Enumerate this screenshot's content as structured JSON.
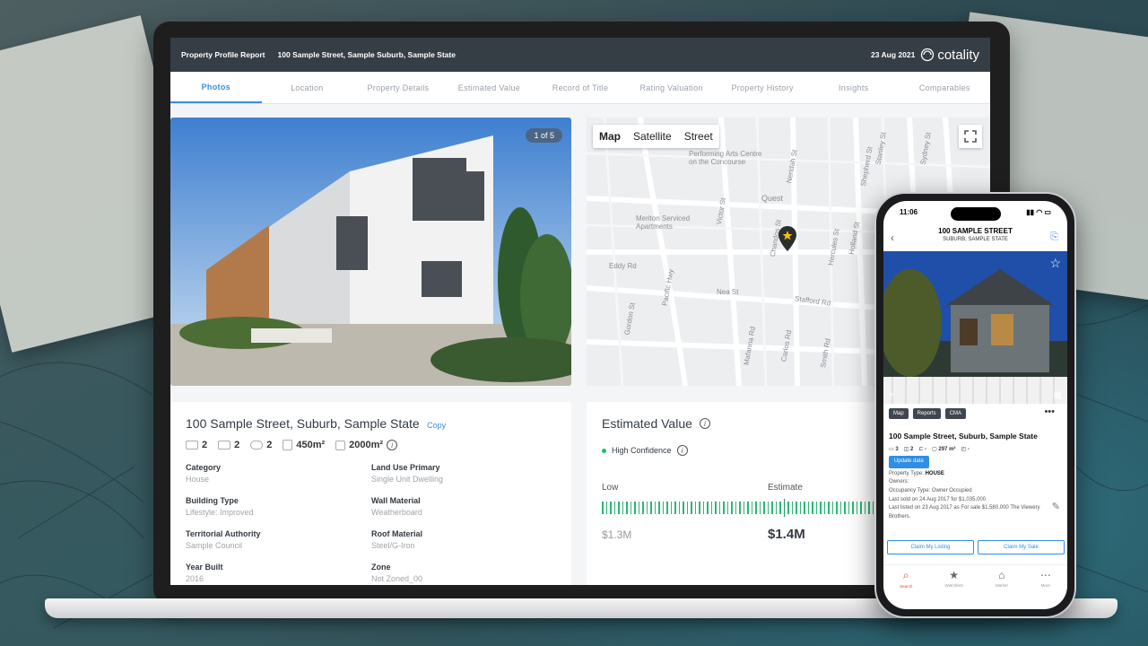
{
  "report": {
    "title": "Property Profile Report",
    "address": "100 Sample Street, Sample Suburb, Sample State",
    "date": "23 Aug 2021",
    "brand": "cotality"
  },
  "tabs": [
    "Photos",
    "Location",
    "Property Details",
    "Estimated Value",
    "Record of Title",
    "Rating Valuation",
    "Property History",
    "Insights",
    "Comparables"
  ],
  "photo": {
    "counter": "1 of 5"
  },
  "map": {
    "modes": [
      "Map",
      "Satellite",
      "Street"
    ],
    "labels": [
      "Performing Arts Centre\non the Concourse",
      "Meriton Serviced\nApartments",
      "Quest",
      "Eddy Rd",
      "Nea St",
      "Stafford Rd",
      "Pacific Hwy",
      "Victor St",
      "Chandos St",
      "Hercules St",
      "Holland St",
      "Stanley St",
      "Sydney St",
      "Neridah St",
      "Shepherd St",
      "Gordon St",
      "Mafanna Rd",
      "Carlos Rd",
      "Smith Rd"
    ]
  },
  "property": {
    "address": "100 Sample Street, Suburb, Sample State",
    "copy": "Copy",
    "beds": "2",
    "baths": "2",
    "cars": "2",
    "floor_area": "450m²",
    "land_area": "2000m²",
    "fields": [
      {
        "k": "Category",
        "v": "House"
      },
      {
        "k": "Land Use Primary",
        "v": "Single Unit Dwelling"
      },
      {
        "k": "Building Type",
        "v": "Lifestyle: Improved"
      },
      {
        "k": "Wall Material",
        "v": "Weatherboard"
      },
      {
        "k": "Territorial Authority",
        "v": "Sample Council"
      },
      {
        "k": "Roof Material",
        "v": "Steel/G-Iron"
      },
      {
        "k": "Year Built",
        "v": "2016"
      },
      {
        "k": "Zone",
        "v": "Not Zoned_00"
      }
    ]
  },
  "estimate": {
    "title": "Estimated Value",
    "confidence": "High Confidence",
    "low_label": "Low",
    "est_label": "Estimate",
    "low": "$1.3M",
    "est": "$1.4M"
  },
  "phone": {
    "time": "11:06",
    "title": "100 SAMPLE STREET",
    "subtitle": "SUBURB, SAMPLE STATE",
    "buttons": [
      "Map",
      "Reports",
      "CMA"
    ],
    "address": "100 Sample Street, Suburb, Sample State",
    "beds": "3",
    "baths": "2",
    "cars": "-",
    "area": "297 m²",
    "land": "-",
    "update": "Update data",
    "type_label": "Property Type:",
    "type": "HOUSE",
    "owners": "Owners:",
    "occupancy": "Occupancy Type: Owner Occupied",
    "sold": "Last sold on 24 Aug 2017 for $1,035,000",
    "listed": "Last listed on 23 Aug 2017 as For sale $1,580,000 The Viewery Brothers.",
    "claim_listing": "Claim My Listing",
    "claim_sale": "Claim My Sale",
    "nav": [
      "Search",
      "Watchlists",
      "Market",
      "More"
    ]
  }
}
